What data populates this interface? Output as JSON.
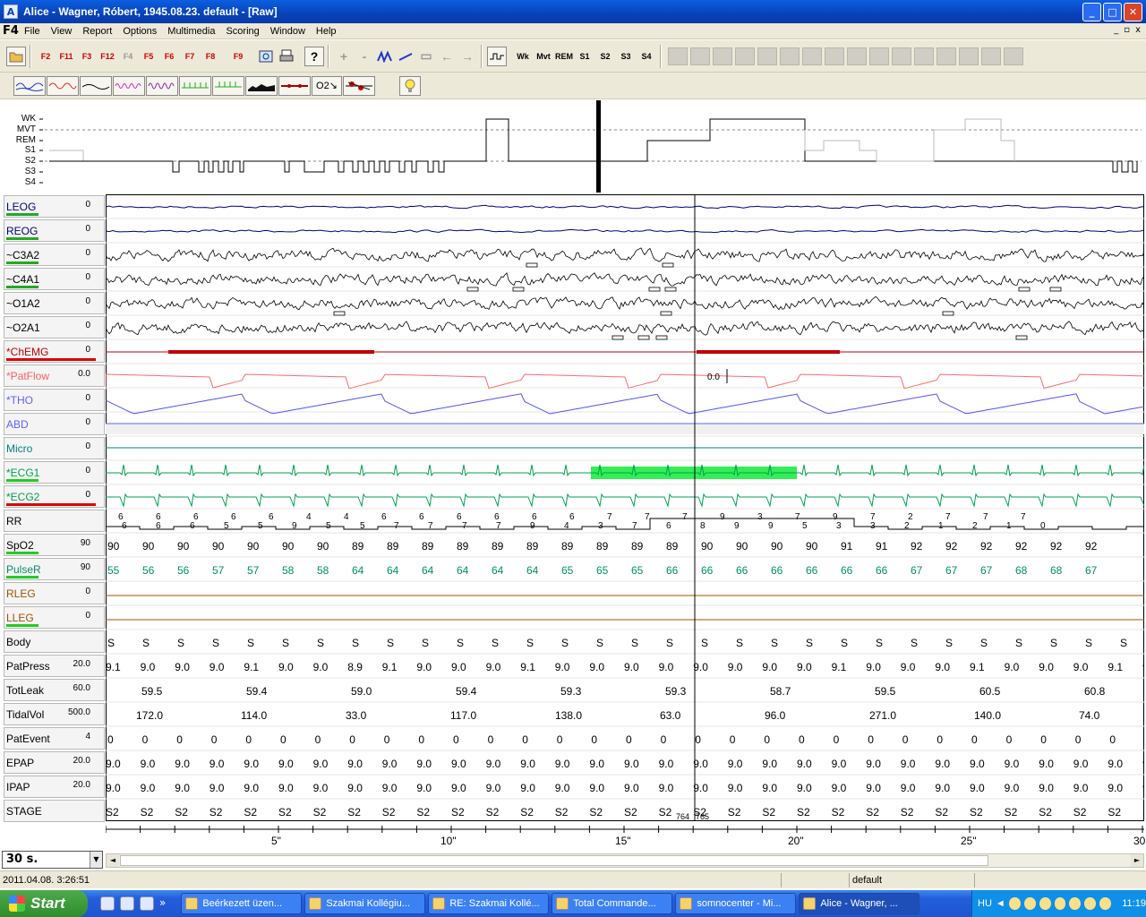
{
  "window": {
    "app_icon": "A",
    "title": "Alice - Wagner, Róbert, 1945.08.23. default - [Raw]",
    "btn_min": "_",
    "btn_max": "□",
    "btn_close": "✕"
  },
  "menu": {
    "f4": "F4",
    "items": [
      "File",
      "View",
      "Report",
      "Options",
      "Multimedia",
      "Scoring",
      "Window",
      "Help"
    ],
    "mdi": [
      "_",
      "▫",
      "x"
    ]
  },
  "toolbar1": {
    "fkeys": [
      "F2",
      "F11",
      "F3",
      "F12",
      "F4",
      "F5",
      "F6",
      "F7",
      "F8",
      "F9"
    ],
    "help": "?",
    "nav": [
      "+",
      "-",
      "",
      "",
      "▭",
      "←",
      "→"
    ],
    "stage_btns": [
      "Wk",
      "Mvt",
      "REM",
      "S1",
      "S2",
      "S3",
      "S4"
    ]
  },
  "toolbar2": {
    "o2_label": "O2↘"
  },
  "hypnogram": {
    "labels": [
      "WK",
      "MVT",
      "REM",
      "S1",
      "S2",
      "S3",
      "S4"
    ]
  },
  "channels": [
    {
      "name": "LEOG",
      "scale": "0",
      "color": "#000080",
      "bar": "#22aa22"
    },
    {
      "name": "REOG",
      "scale": "0",
      "color": "#000080",
      "bar": "#22aa22"
    },
    {
      "name": "~C3A2",
      "scale": "0",
      "color": "#000000",
      "bar": "#22aa22"
    },
    {
      "name": "~C4A1",
      "scale": "0",
      "color": "#000000",
      "bar": "#22aa22"
    },
    {
      "name": "~O1A2",
      "scale": "0",
      "color": "#000000",
      "bar": ""
    },
    {
      "name": "~O2A1",
      "scale": "0",
      "color": "#000000",
      "bar": ""
    },
    {
      "name": "*ChEMG",
      "scale": "0",
      "color": "#c00000",
      "bar": "#dd0000"
    },
    {
      "name": "*PatFlow",
      "scale": "0.0",
      "color": "#ff6060",
      "bar": ""
    },
    {
      "name": "*THO",
      "scale": "0",
      "color": "#6060ff",
      "bar": ""
    },
    {
      "name": "ABD",
      "scale": "0",
      "color": "#6060ff",
      "bar": ""
    },
    {
      "name": "Micro",
      "scale": "0",
      "color": "#008080",
      "bar": ""
    },
    {
      "name": "*ECG1",
      "scale": "0",
      "color": "#00a050",
      "bar": "#22cc22"
    },
    {
      "name": "*ECG2",
      "scale": "0",
      "color": "#00a050",
      "bar": "#dd0000"
    },
    {
      "name": "RR",
      "scale": "",
      "color": "#000000",
      "bar": ""
    },
    {
      "name": "SpO2",
      "scale": "90",
      "color": "#000000",
      "bar": "#22cc22"
    },
    {
      "name": "PulseR",
      "scale": "90",
      "color": "#009060",
      "bar": "#22cc22"
    },
    {
      "name": "RLEG",
      "scale": "0",
      "color": "#a05000",
      "bar": ""
    },
    {
      "name": "LLEG",
      "scale": "0",
      "color": "#a05000",
      "bar": "#22cc22"
    },
    {
      "name": "Body",
      "scale": "",
      "color": "#000000",
      "bar": ""
    },
    {
      "name": "PatPress",
      "scale": "20.0",
      "color": "#000000",
      "bar": ""
    },
    {
      "name": "TotLeak",
      "scale": "60.0",
      "color": "#000000",
      "bar": ""
    },
    {
      "name": "TidalVol",
      "scale": "500.0",
      "color": "#000000",
      "bar": ""
    },
    {
      "name": "PatEvent",
      "scale": "4",
      "color": "#000000",
      "bar": ""
    },
    {
      "name": "EPAP",
      "scale": "20.0",
      "color": "#000000",
      "bar": ""
    },
    {
      "name": "IPAP",
      "scale": "20.0",
      "color": "#000000",
      "bar": ""
    },
    {
      "name": "STAGE",
      "scale": "",
      "color": "#000000",
      "bar": ""
    }
  ],
  "values": {
    "patflow_cursor": "0.0",
    "rr_top": [
      "6",
      "6",
      "6",
      "6",
      "6",
      "4",
      "4",
      "6",
      "6",
      "6",
      "6",
      "6",
      "6",
      "7",
      "7",
      "7",
      "9",
      "3",
      "7",
      "9",
      "7",
      "2",
      "7",
      "7",
      "7"
    ],
    "rr_bot": [
      "6",
      "6",
      "6",
      "5",
      "5",
      "9",
      "5",
      "5",
      "7",
      "7",
      "7",
      "7",
      "9",
      "4",
      "3",
      "7",
      "6",
      "8",
      "9",
      "9",
      "5",
      "3",
      "3",
      "2",
      "1",
      "2",
      "1",
      "0"
    ],
    "spo2": [
      "90",
      "90",
      "90",
      "90",
      "90",
      "90",
      "90",
      "89",
      "89",
      "89",
      "89",
      "89",
      "89",
      "89",
      "89",
      "89",
      "89",
      "90",
      "90",
      "90",
      "90",
      "91",
      "91",
      "92",
      "92",
      "92",
      "92",
      "92",
      "92"
    ],
    "pulse": [
      "55",
      "56",
      "56",
      "57",
      "57",
      "58",
      "58",
      "64",
      "64",
      "64",
      "64",
      "64",
      "64",
      "65",
      "65",
      "65",
      "66",
      "66",
      "66",
      "66",
      "66",
      "66",
      "66",
      "67",
      "67",
      "67",
      "68",
      "68",
      "67"
    ],
    "body": [
      "S",
      "S",
      "S",
      "S",
      "S",
      "S",
      "S",
      "S",
      "S",
      "S",
      "S",
      "S",
      "S",
      "S",
      "S",
      "S",
      "S",
      "S",
      "S",
      "S",
      "S",
      "S",
      "S",
      "S",
      "S",
      "S",
      "S",
      "S",
      "S",
      "S"
    ],
    "patpress": [
      "9.1",
      "9.0",
      "9.0",
      "9.0",
      "9.1",
      "9.0",
      "9.0",
      "8.9",
      "9.1",
      "9.0",
      "9.0",
      "9.0",
      "9.1",
      "9.0",
      "9.0",
      "9.0",
      "9.0",
      "9.0",
      "9.0",
      "9.0",
      "9.0",
      "9.1",
      "9.0",
      "9.0",
      "9.0",
      "9.1",
      "9.0",
      "9.0",
      "9.0",
      "9.1",
      "9.0"
    ],
    "totleak": [
      "59.5",
      "59.4",
      "59.0",
      "59.4",
      "59.3",
      "59.3",
      "58.7",
      "59.5",
      "60.5",
      "60.8"
    ],
    "tidalvol": [
      "172.0",
      "114.0",
      "33.0",
      "117.0",
      "138.0",
      "63.0",
      "96.0",
      "271.0",
      "140.0",
      "74.0"
    ],
    "patevent": [
      "0",
      "0",
      "0",
      "0",
      "0",
      "0",
      "0",
      "0",
      "0",
      "0",
      "0",
      "0",
      "0",
      "0",
      "0",
      "0",
      "0",
      "0",
      "0",
      "0",
      "0",
      "0",
      "0",
      "0",
      "0",
      "0",
      "0",
      "0",
      "0",
      "0",
      "0",
      "0",
      "0"
    ],
    "epap": [
      "9.0",
      "9.0",
      "9.0",
      "9.0",
      "9.0",
      "9.0",
      "9.0",
      "9.0",
      "9.0",
      "9.0",
      "9.0",
      "9.0",
      "9.0",
      "9.0",
      "9.0",
      "9.0",
      "9.0",
      "9.0",
      "9.0",
      "9.0",
      "9.0",
      "9.0",
      "9.0",
      "9.0",
      "9.0",
      "9.0",
      "9.0",
      "9.0",
      "9.0",
      "9.0",
      "9.0",
      "9.0"
    ],
    "ipap": [
      "9.0",
      "9.0",
      "9.0",
      "9.0",
      "9.0",
      "9.0",
      "9.0",
      "9.0",
      "9.0",
      "9.0",
      "9.0",
      "9.0",
      "9.0",
      "9.0",
      "9.0",
      "9.0",
      "9.0",
      "9.0",
      "9.0",
      "9.0",
      "9.0",
      "9.0",
      "9.0",
      "9.0",
      "9.0",
      "9.0",
      "9.0",
      "9.0",
      "9.0",
      "9.0",
      "9.0",
      "9.0"
    ],
    "stage": [
      "S2",
      "S2",
      "S2",
      "S2",
      "S2",
      "S2",
      "S2",
      "S2",
      "S2",
      "S2",
      "S2",
      "S2",
      "S2",
      "S2",
      "S2",
      "S2",
      "S2",
      "S2",
      "S2",
      "S2",
      "S2",
      "S2",
      "S2",
      "S2",
      "S2",
      "S2",
      "S2",
      "S2",
      "S2",
      "S2",
      "S2",
      "S2"
    ],
    "epoch_marks": [
      "764",
      "765"
    ]
  },
  "timeaxis": {
    "ticks": [
      "5\"",
      "10\"",
      "15\"",
      "20\"",
      "25\"",
      "30"
    ]
  },
  "epoch": {
    "value": "30 s.",
    "arrow": "▼"
  },
  "scroll": {
    "left": "◄",
    "right": "►"
  },
  "status": {
    "datetime": "2011.04.08. 3:26:51",
    "profile": "default"
  },
  "taskbar": {
    "start": "Start",
    "more": "»",
    "tasks": [
      "Beérkezett üzen...",
      "Szakmai Kollégiu...",
      "RE: Szakmai Kollé...",
      "Total Commande...",
      "somnocenter - Mi...",
      "Alice - Wagner, ..."
    ],
    "lang": "HU",
    "time": "11:19"
  },
  "colors": {
    "titlebar": "#0842b8",
    "ecg_highlight": "#33ee55",
    "chemg": "#c00000"
  }
}
